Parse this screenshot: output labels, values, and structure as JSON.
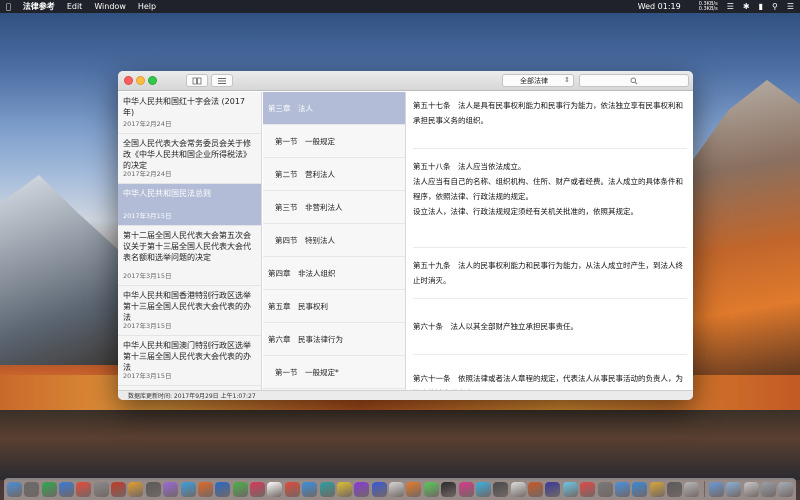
{
  "menubar": {
    "app_name": "法律参考",
    "menus": [
      "Edit",
      "Window",
      "Help"
    ],
    "clock": "Wed 01:19",
    "net_up": "0.3KB/s",
    "net_down": "0.3KB/s"
  },
  "toolbar": {
    "scope_selected": "全部法律"
  },
  "laws": [
    {
      "title": "中华人民共和国红十字会法 (2017年)",
      "date": "2017年2月24日"
    },
    {
      "title": "全国人民代表大会常务委员会关于修改《中华人民共和国企业所得税法》的决定",
      "date": "2017年2月24日"
    },
    {
      "title": "中华人民共和国民法总则",
      "date": "2017年3月15日"
    },
    {
      "title": "第十二届全国人民代表大会第五次会议关于第十三届全国人民代表大会代表名额和选举问题的决定",
      "date": "2017年3月15日"
    },
    {
      "title": "中华人民共和国香港特别行政区选举第十三届全国人民代表大会代表的办法",
      "date": "2017年3月15日"
    },
    {
      "title": "中华人民共和国澳门特别行政区选举第十三届全国人民代表大会代表的办法",
      "date": "2017年3月15日"
    }
  ],
  "chapters": [
    "第三章　法人",
    "第一节　一般规定",
    "第二节　营利法人",
    "第三节　非营利法人",
    "第四节　特别法人",
    "第四章　非法人组织",
    "第五章　民事权利",
    "第六章　民事法律行为",
    "第一节　一般规定*"
  ],
  "articles": [
    [
      "第五十七条　法人是具有民事权利能力和民事行为能力，依法独立享有民事权利和承担民事义务的组织。"
    ],
    [
      "第五十八条　法人应当依法成立。",
      "法人应当有自己的名称、组织机构、住所、财产或者经费。法人成立的具体条件和程序，依照法律、行政法规的规定。",
      "设立法人，法律、行政法规规定须经有关机关批准的，依照其规定。"
    ],
    [
      "第五十九条　法人的民事权利能力和民事行为能力，从法人成立时产生，到法人终止时消灭。"
    ],
    [
      "第六十条　法人以其全部财产独立承担民事责任。"
    ],
    [
      "第六十一条　依照法律或者法人章程的规定，代表法人从事民事活动的负责人，为法人的法定代表人。"
    ]
  ],
  "status": {
    "db_updated": "数据库更新时间: 2017年9月29日 上午1:07:27"
  },
  "dock_colors": [
    "#4a8fd8",
    "#6a6a6a",
    "#2fa84f",
    "#3a7bd5",
    "#e84a3a",
    "#8a8a8a",
    "#c23a2a",
    "#e0a030",
    "#5a5a5a",
    "#9a6ad8",
    "#3aa0e0",
    "#e06a2a",
    "#2a6ac8",
    "#4ab04a",
    "#d83a5a",
    "#ffffff",
    "#e04a3a",
    "#3a90e0",
    "#2aa0a0",
    "#e0c030",
    "#8a3ad8",
    "#3a5ad8",
    "#d8d8d8",
    "#e87a2a",
    "#5ac85a",
    "#2a2a2a",
    "#d83a8a",
    "#3ab0e0",
    "#4a4a4a",
    "#e0e0e0",
    "#c85a2a",
    "#3a3a9a",
    "#6ac8e8",
    "#e04a4a",
    "#7a7a7a",
    "#4a90e2",
    "#3a8ad8",
    "#d8a83a",
    "#5a5a5a",
    "#b8b8b8",
    "#6a9ad8",
    "#8ab0d8",
    "#c8c8c8",
    "#9aa0a8",
    "#a8b0b8"
  ]
}
